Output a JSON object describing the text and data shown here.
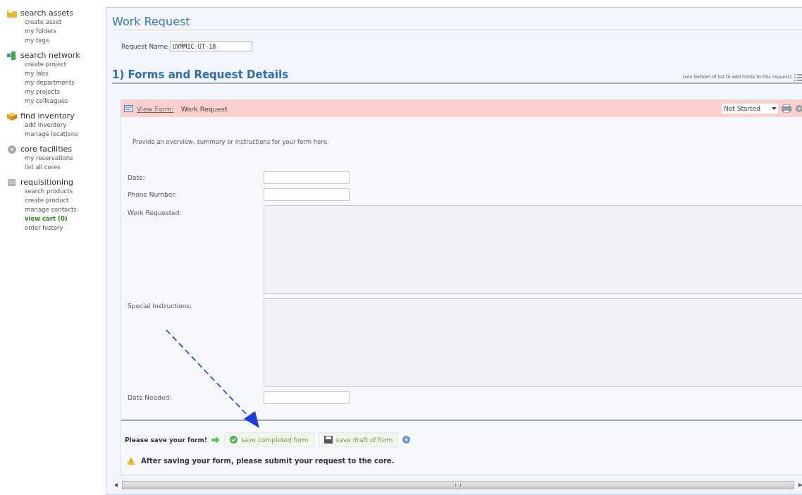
{
  "sidebar": {
    "groups": [
      {
        "title": "search assets",
        "items": [
          {
            "label": "create asset",
            "selected": false
          },
          {
            "label": "my folders",
            "selected": false
          },
          {
            "label": "my tags",
            "selected": false
          }
        ]
      },
      {
        "title": "search network",
        "items": [
          {
            "label": "create project",
            "selected": false
          },
          {
            "label": "my labs",
            "selected": false
          },
          {
            "label": "my departments",
            "selected": false
          },
          {
            "label": "my projects",
            "selected": false
          },
          {
            "label": "my colleagues",
            "selected": false
          }
        ]
      },
      {
        "title": "find inventory",
        "items": [
          {
            "label": "add inventory",
            "selected": false
          },
          {
            "label": "manage locations",
            "selected": false
          }
        ]
      },
      {
        "title": "core facilities",
        "items": [
          {
            "label": "my reservations",
            "selected": false
          },
          {
            "label": "list all cores",
            "selected": false
          }
        ]
      },
      {
        "title": "requisitioning",
        "items": [
          {
            "label": "search products",
            "selected": false
          },
          {
            "label": "create product",
            "selected": false
          },
          {
            "label": "manage contacts",
            "selected": false
          },
          {
            "label": "view cart (0)",
            "selected": true
          },
          {
            "label": "order history",
            "selected": false
          }
        ]
      }
    ]
  },
  "main": {
    "title": "Work Request",
    "request_name": {
      "label": "Request Name",
      "value": "UVMMIC-UT-18"
    },
    "section": {
      "title": "1) Forms and Request Details",
      "hint": "(see bottom of list to add items to this request)"
    },
    "form": {
      "link": "View Form:",
      "name": "Work Request",
      "status": "Not Started",
      "intro": "Provide an overview, summary or instructions for your form here.",
      "fields": [
        {
          "label": "Date:",
          "kind": "text"
        },
        {
          "label": "Phone Number:",
          "kind": "text"
        },
        {
          "label": "Work Requested:",
          "kind": "textarea"
        },
        {
          "label": "Special Instructions:",
          "kind": "textarea"
        },
        {
          "label": "Date Needed:",
          "kind": "text"
        }
      ],
      "save_prompt": "Please save your form!",
      "buttons": [
        {
          "label": "save completed form",
          "kind": "complete"
        },
        {
          "label": "save draft of form",
          "kind": "draft"
        }
      ],
      "warning": "After saving your form, please submit your request to the core."
    }
  }
}
